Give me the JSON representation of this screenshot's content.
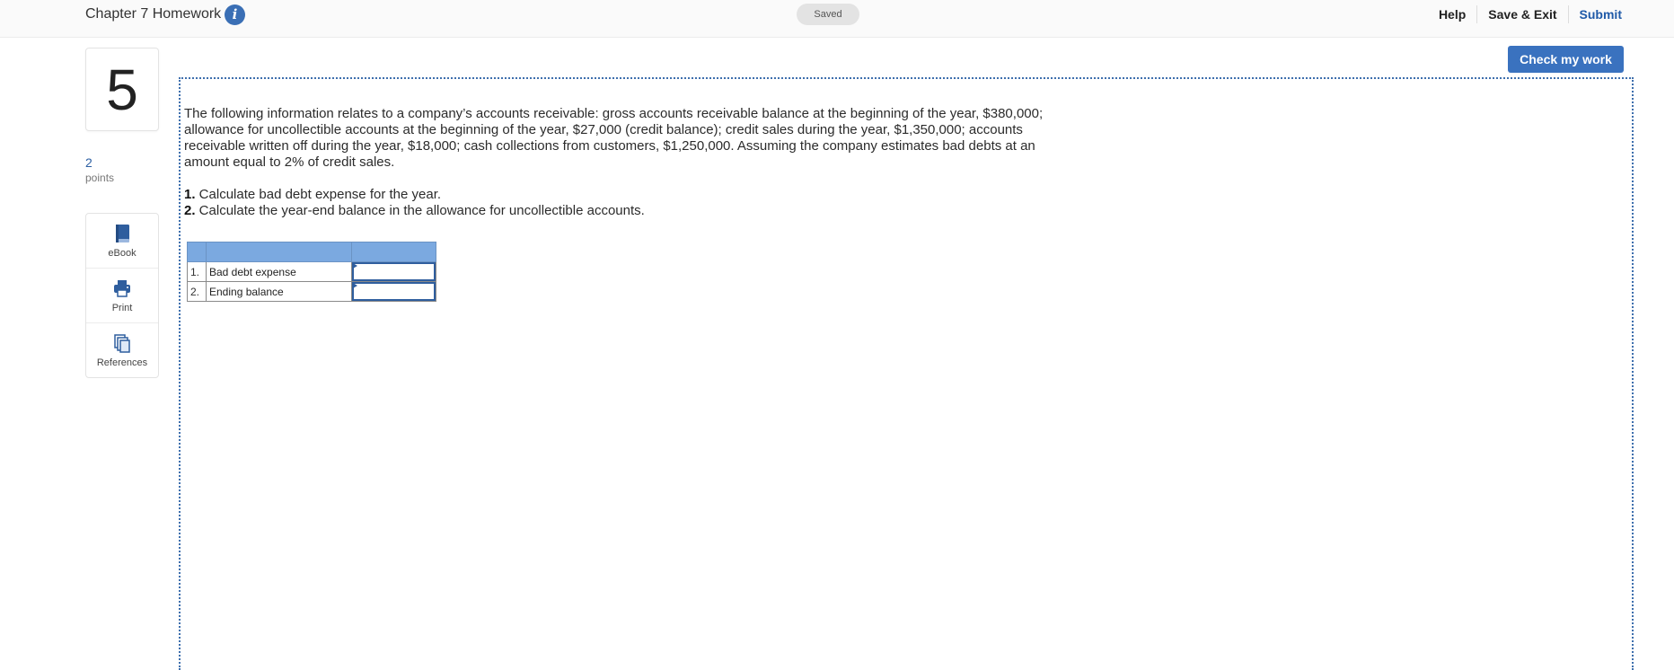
{
  "header": {
    "assignment_title": "Chapter 7 Homework",
    "info_glyph": "i",
    "saved_status": "Saved",
    "links": {
      "help": "Help",
      "save_exit": "Save & Exit",
      "submit": "Submit"
    }
  },
  "sidebar": {
    "question_number": "5",
    "points_value": "2",
    "points_label": "points",
    "tools": [
      {
        "label": "eBook",
        "icon": "book-icon"
      },
      {
        "label": "Print",
        "icon": "printer-icon"
      },
      {
        "label": "References",
        "icon": "documents-icon"
      }
    ]
  },
  "actions": {
    "check_my_work": "Check my work"
  },
  "question": {
    "text": "The following information relates to a company’s accounts receivable: gross accounts receivable balance at the beginning of the year, $380,000; allowance for uncollectible accounts at the beginning of the year, $27,000 (credit balance); credit sales during the year, $1,350,000; accounts receivable written off during the year, $18,000; cash collections from customers, $1,250,000. Assuming the company estimates bad debts at an amount equal to 2% of credit sales.",
    "steps": [
      {
        "num": "1.",
        "text": " Calculate bad debt expense for the year."
      },
      {
        "num": "2.",
        "text": " Calculate the year-end balance in the allowance for uncollectible accounts."
      }
    ]
  },
  "answer_table": {
    "rows": [
      {
        "num": "1.",
        "label": "Bad debt expense",
        "value": ""
      },
      {
        "num": "2.",
        "label": "Ending balance",
        "value": ""
      }
    ]
  },
  "colors": {
    "accent_blue": "#3a72bf",
    "table_header": "#7ba9e0",
    "frame_dotted": "#3e6fad"
  }
}
